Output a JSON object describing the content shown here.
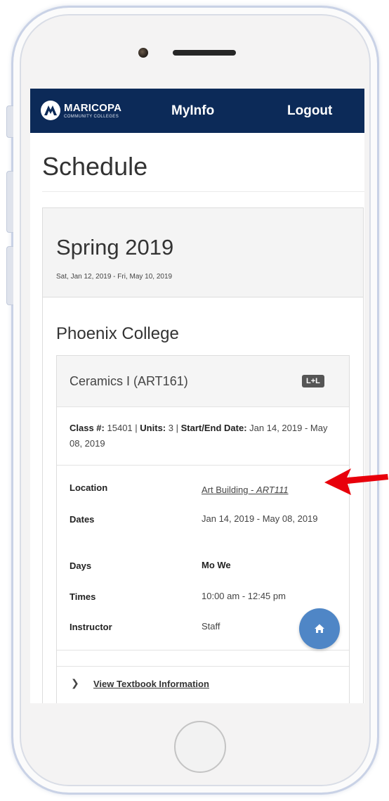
{
  "navbar": {
    "brand_name": "MARICOPA",
    "brand_sub": "COMMUNITY COLLEGES",
    "myinfo_label": "MyInfo",
    "logout_label": "Logout"
  },
  "page": {
    "title": "Schedule"
  },
  "term": {
    "name": "Spring 2019",
    "dates": "Sat, Jan 12, 2019 - Fri, May 10, 2019",
    "college": "Phoenix College"
  },
  "course": {
    "title": "Ceramics I (ART161)",
    "badge": "L+L",
    "class_label": "Class #:",
    "class_value": "15401",
    "units_label": "Units:",
    "units_value": "3",
    "startend_label": "Start/End Date:",
    "startend_value": "Jan 14, 2019 - May 08, 2019",
    "details": {
      "location_label": "Location",
      "location_building": "Art Building - ",
      "location_room": "ART111",
      "dates_label": "Dates",
      "dates_value": "Jan 14, 2019 - May 08, 2019",
      "days_label": "Days",
      "days_value": "Mo We",
      "times_label": "Times",
      "times_value": "10:00 am - 12:45 pm",
      "instructor_label": "Instructor",
      "instructor_value": "Staff"
    },
    "textbook_link": "View Textbook Information"
  },
  "colors": {
    "navbar": "#0c2a58",
    "fab": "#4f86c6",
    "arrow": "#e8000b"
  },
  "icons": {
    "fab": "home-icon",
    "textbook_toggle": "chevron-right-icon",
    "annotation": "red-arrow-icon"
  }
}
